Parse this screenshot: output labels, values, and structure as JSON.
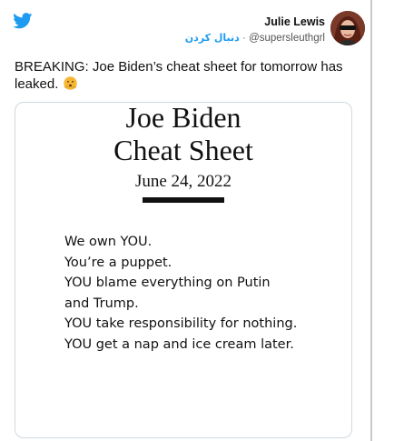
{
  "author": {
    "name": "Julie Lewis",
    "follow_label": "دنبال کردن",
    "separator": "·",
    "handle": "@supersleuthgrl"
  },
  "tweet": {
    "text": "BREAKING: Joe Biden’s cheat sheet for tomorrow has leaked."
  },
  "sheet": {
    "title_line1": "Joe Biden",
    "title_line2": "Cheat Sheet",
    "date": "June 24, 2022",
    "lines": [
      " We own YOU.",
      "You’re a puppet.",
      "YOU blame everything on Putin",
      "and Trump.",
      "YOU take responsibility for nothing.",
      "YOU get a nap and ice cream later."
    ]
  },
  "icons": {
    "brand": "twitter-bird-icon",
    "emoji": "hushed-face-emoji-icon"
  },
  "colors": {
    "twitter_blue": "#1d9bf0",
    "text": "#111111",
    "muted": "#555555",
    "media_border": "#cfd9de"
  }
}
